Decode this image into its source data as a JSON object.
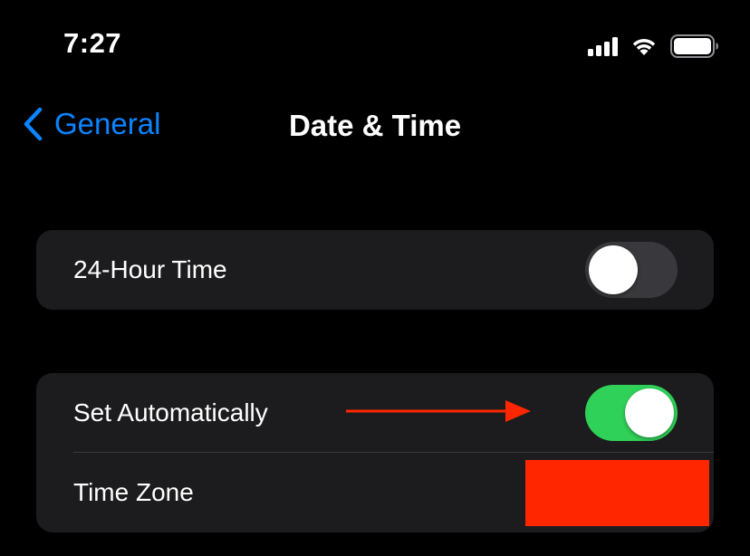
{
  "status_bar": {
    "time": "7:27",
    "icons": [
      "cellular-signal-icon",
      "wifi-icon",
      "battery-icon"
    ]
  },
  "nav": {
    "back_label": "General",
    "title": "Date & Time"
  },
  "settings": {
    "hour_24": {
      "label": "24-Hour Time",
      "enabled": false
    },
    "set_automatically": {
      "label": "Set Automatically",
      "enabled": true
    },
    "time_zone": {
      "label": "Time Zone"
    }
  },
  "colors": {
    "accent": "#0a84ff",
    "toggle_on": "#30d158",
    "toggle_off": "#39393d",
    "annotation": "#ff2600",
    "cell_background": "#1c1c1e"
  }
}
